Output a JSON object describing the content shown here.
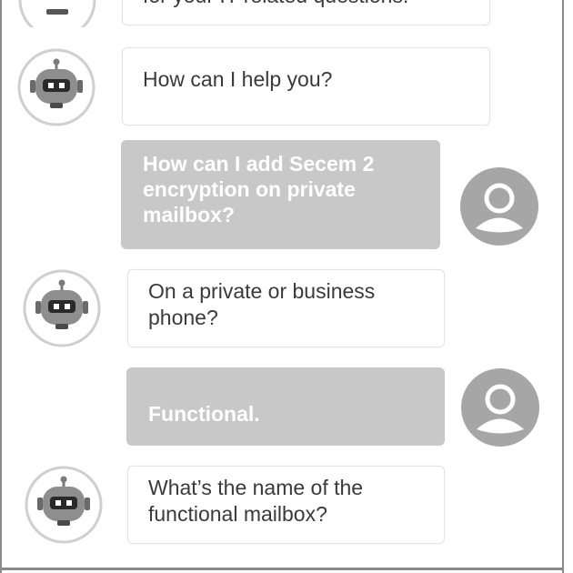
{
  "conversation": {
    "messages": [
      {
        "sender": "bot",
        "text": "for your IT related questions."
      },
      {
        "sender": "bot",
        "text": "How can I help you?"
      },
      {
        "sender": "user",
        "lines": [
          "How can I add Secem 2",
          "encryption on private",
          "mailbox?"
        ]
      },
      {
        "sender": "bot",
        "lines": [
          "On a private or business",
          "phone?"
        ]
      },
      {
        "sender": "user",
        "text": "Functional."
      },
      {
        "sender": "bot",
        "lines": [
          "What’s the name of the",
          "functional mailbox?"
        ]
      }
    ]
  },
  "icons": {
    "bot_avatar": "robot-icon",
    "user_avatar": "user-icon"
  },
  "colors": {
    "user_bubble": "#c8c8c8",
    "bot_bubble": "#ffffff",
    "bot_text": "#3a3a3a",
    "avatar_gray": "#9e9e9e"
  }
}
